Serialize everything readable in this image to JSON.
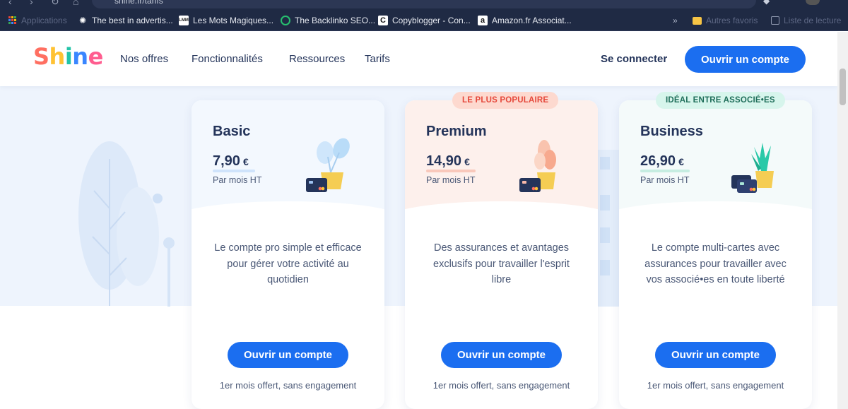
{
  "browser": {
    "url": "shine.fr/tarifs",
    "bookmarks": [
      {
        "label": "Applications",
        "icon": "apps-grid-icon",
        "dim": true
      },
      {
        "label": "The best in advertis...",
        "icon": "octopus-icon"
      },
      {
        "label": "Les Mots Magiques...",
        "icon": "lmm-icon"
      },
      {
        "label": "The Backlinko SEO...",
        "icon": "backlinko-icon"
      },
      {
        "label": "Copyblogger - Con...",
        "icon": "copyblogger-icon"
      },
      {
        "label": "Amazon.fr Associat...",
        "icon": "amazon-icon"
      }
    ],
    "more_bookmarks": "»",
    "other_favorites": "Autres favoris",
    "reading_list": "Liste de lecture"
  },
  "header": {
    "logo": [
      "S",
      "h",
      "i",
      "n",
      "e"
    ],
    "logo_colors": [
      "#ff6f61",
      "#ffc233",
      "#23c4a8",
      "#3a86ff",
      "#ff5d8f"
    ],
    "nav": [
      "Nos offres",
      "Fonctionnalités",
      "Ressources",
      "Tarifs"
    ],
    "login": "Se connecter",
    "cta": "Ouvrir un compte"
  },
  "plans": [
    {
      "name": "Basic",
      "price": "7,90",
      "currency": "€",
      "period": "Par mois HT",
      "description": "Le compte pro simple et efficace pour gérer votre activité au quotidien",
      "cta": "Ouvrir un compte",
      "note": "1er mois offert, sans engagement",
      "head_color": "#f3f8fe",
      "accent": "#bcd9f5",
      "illustration": "blue-plant-card-icon"
    },
    {
      "name": "Premium",
      "price": "14,90",
      "currency": "€",
      "period": "Par mois HT",
      "description": "Des assurances et avantages exclusifs pour travailler l'esprit libre",
      "cta": "Ouvrir un compte",
      "note": "1er mois offert, sans engagement",
      "badge": "LE PLUS POPULAIRE",
      "head_color": "#fdf0ec",
      "accent": "#f7b8a8",
      "illustration": "peach-plant-card-icon"
    },
    {
      "name": "Business",
      "price": "26,90",
      "currency": "€",
      "period": "Par mois HT",
      "description": "Le compte multi-cartes avec assurances pour travailler avec vos associé•es en toute liberté",
      "cta": "Ouvrir un compte",
      "note": "1er mois offert, sans engagement",
      "badge": "IDÉAL ENTRE ASSOCIÉ•ES",
      "head_color": "#f4fafa",
      "accent": "#a8e5d6",
      "illustration": "green-plant-cards-icon"
    }
  ],
  "colors": {
    "primary": "#1b6ef0",
    "text_dark": "#24345a",
    "badge_popular_bg": "#fdd9cf",
    "badge_popular_text": "#e5473a",
    "badge_assoc_bg": "#d7f5ec",
    "badge_assoc_text": "#1f6e5a"
  }
}
